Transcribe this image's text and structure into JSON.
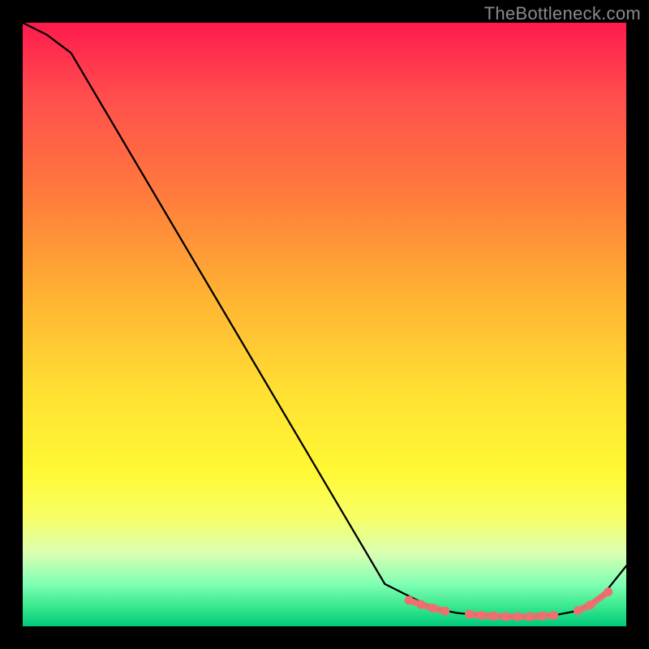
{
  "watermark": "TheBottleneck.com",
  "chart_data": {
    "type": "line",
    "title": "",
    "xlabel": "",
    "ylabel": "",
    "xlim": [
      0,
      100
    ],
    "ylim": [
      0,
      100
    ],
    "series": [
      {
        "name": "bottleneck-curve",
        "x": [
          0,
          4,
          8,
          60,
          68,
          72,
          76,
          80,
          84,
          88,
          92,
          96,
          100
        ],
        "y": [
          100,
          98,
          95,
          7,
          3,
          2.2,
          1.8,
          1.6,
          1.6,
          1.8,
          2.6,
          5.0,
          10
        ]
      }
    ],
    "markers": {
      "name": "highlighted-range",
      "color": "#ef6f6f",
      "x": [
        64,
        66,
        68,
        70,
        74,
        76,
        78,
        80,
        82,
        84,
        86,
        88,
        92,
        94,
        97
      ],
      "y": [
        4.3,
        3.6,
        3.0,
        2.5,
        2.0,
        1.8,
        1.7,
        1.6,
        1.6,
        1.6,
        1.7,
        1.8,
        2.6,
        3.5,
        5.7
      ]
    },
    "background": {
      "type": "vertical-gradient",
      "stops": [
        {
          "pos": 0.0,
          "color": "#ff1a4d"
        },
        {
          "pos": 0.5,
          "color": "#ffd633"
        },
        {
          "pos": 0.85,
          "color": "#f0ff80"
        },
        {
          "pos": 1.0,
          "color": "#00c97a"
        }
      ]
    }
  }
}
